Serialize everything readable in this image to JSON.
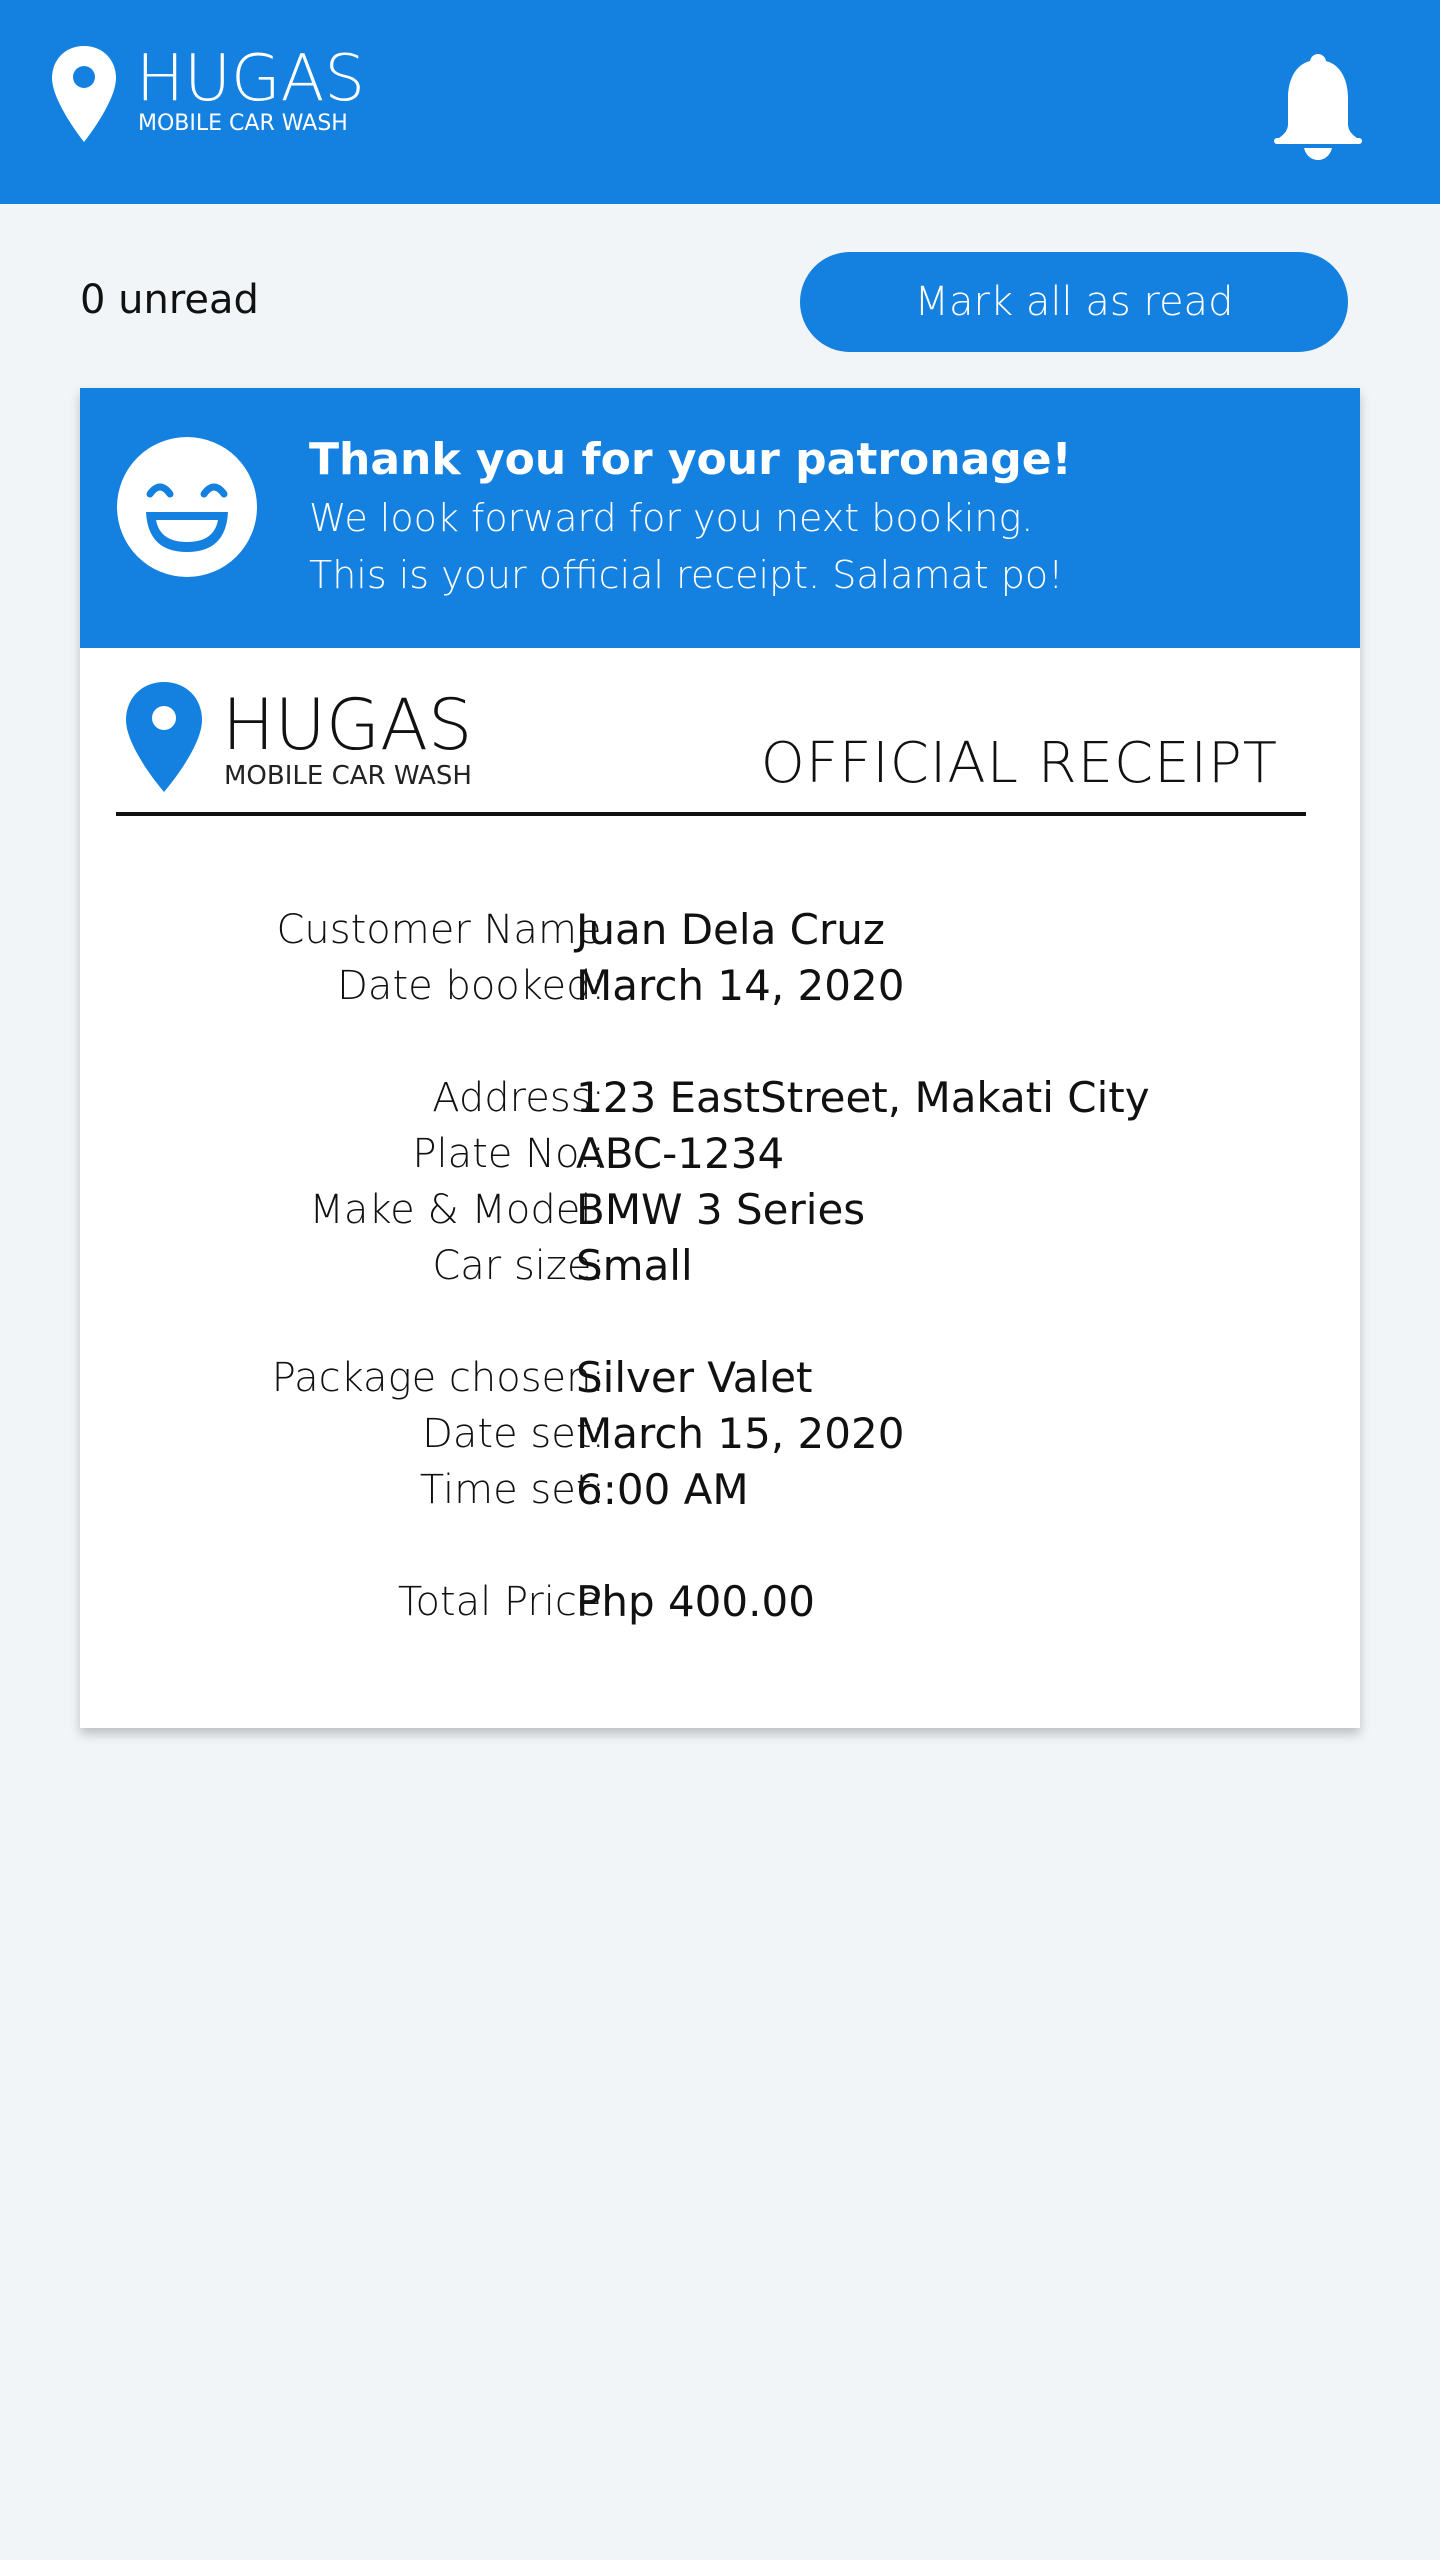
{
  "header": {
    "brand_name": "HUGAS",
    "brand_tagline": "MOBILE CAR WASH",
    "notification_icon": "bell-icon",
    "accent_color": "#1480e0"
  },
  "toolbar": {
    "unread_label": "0 unread",
    "mark_all_label": "Mark all as read"
  },
  "notification": {
    "icon": "smiley-icon",
    "title": "Thank you for your patronage!",
    "line1": "We look forward for you next booking.",
    "line2": "This is your official receipt. Salamat po!"
  },
  "receipt": {
    "brand_name": "HUGAS",
    "brand_tagline": "MOBILE CAR WASH",
    "title": "OFFICIAL RECEIPT",
    "fields": [
      {
        "label": "Customer Name:",
        "value": "Juan Dela Cruz"
      },
      {
        "label": "Date booked:",
        "value": "March 14, 2020"
      },
      {
        "label": "Address:",
        "value": "123 EastStreet, Makati City"
      },
      {
        "label": "Plate No.:",
        "value": "ABC-1234"
      },
      {
        "label": "Make & Model:",
        "value": "BMW 3 Series"
      },
      {
        "label": "Car size:",
        "value": "Small"
      },
      {
        "label": "Package chosen:",
        "value": "Silver Valet"
      },
      {
        "label": "Date set:",
        "value": "March 15, 2020"
      },
      {
        "label": "Time set:",
        "value": "6:00 AM"
      },
      {
        "label": "Total Price:",
        "value": "Php 400.00"
      }
    ]
  }
}
